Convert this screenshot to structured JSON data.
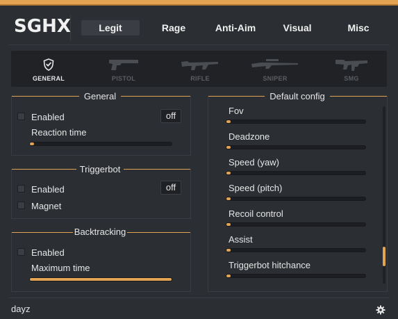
{
  "app": {
    "logo": "SGHX"
  },
  "tabs": [
    {
      "label": "Legit",
      "active": true
    },
    {
      "label": "Rage",
      "active": false
    },
    {
      "label": "Anti-Aim",
      "active": false
    },
    {
      "label": "Visual",
      "active": false
    },
    {
      "label": "Misc",
      "active": false
    }
  ],
  "weapon_tabs": [
    {
      "label": "GENERAL",
      "icon": "shield-icon",
      "active": true
    },
    {
      "label": "PISTOL",
      "icon": "pistol-icon",
      "active": false
    },
    {
      "label": "RIFLE",
      "icon": "rifle-icon",
      "active": false
    },
    {
      "label": "SNIPER",
      "icon": "sniper-icon",
      "active": false
    },
    {
      "label": "SMG",
      "icon": "smg-icon",
      "active": false
    }
  ],
  "general": {
    "title": "General",
    "enabled_label": "Enabled",
    "enabled_key": "off",
    "reaction_label": "Reaction time",
    "reaction_value": 0.01
  },
  "triggerbot": {
    "title": "Triggerbot",
    "enabled_label": "Enabled",
    "enabled_key": "off",
    "magnet_label": "Magnet"
  },
  "backtracking": {
    "title": "Backtracking",
    "enabled_label": "Enabled",
    "max_time_label": "Maximum time",
    "max_time_value": 1.0
  },
  "default_config": {
    "title": "Default config",
    "sliders": [
      {
        "label": "Fov",
        "value": 0.01
      },
      {
        "label": "Deadzone",
        "value": 0.01
      },
      {
        "label": "Speed (yaw)",
        "value": 0.01
      },
      {
        "label": "Speed (pitch)",
        "value": 0.01
      },
      {
        "label": "Recoil control",
        "value": 0.01
      },
      {
        "label": "Assist",
        "value": 0.01
      },
      {
        "label": "Triggerbot hitchance",
        "value": 0.01
      }
    ],
    "scroll_position": 0.89
  },
  "footer": {
    "text": "dayz",
    "icon": "gear-icon"
  },
  "colors": {
    "accent": "#e2a353",
    "background": "#2b2e33",
    "panel": "#202226",
    "text": "#e6e6e6",
    "muted": "#5a5d62"
  }
}
